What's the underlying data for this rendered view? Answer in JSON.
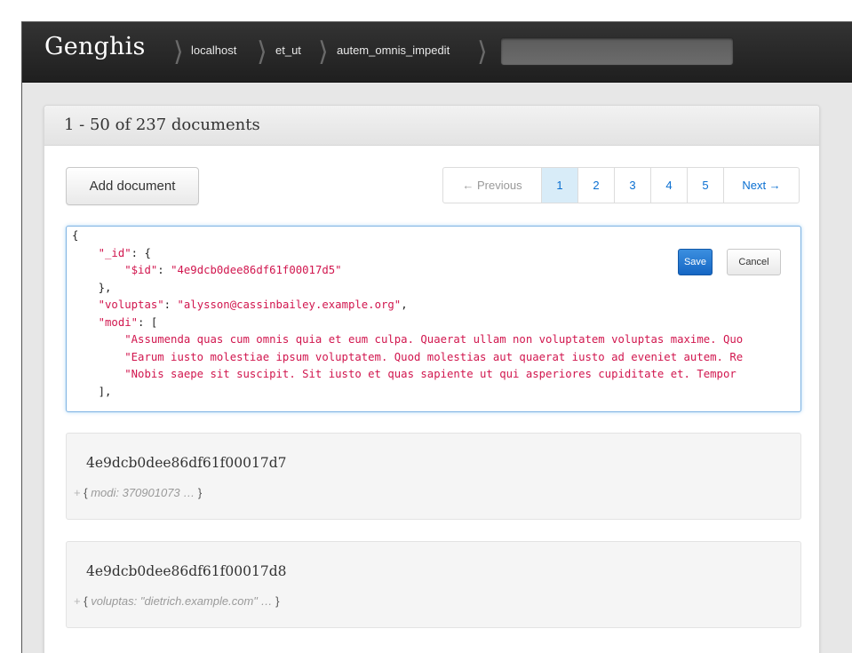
{
  "app": {
    "brand": "Genghis"
  },
  "breadcrumbs": [
    "localhost",
    "et_ut",
    "autem_omnis_impedit"
  ],
  "search": {
    "value": "",
    "placeholder": ""
  },
  "panel": {
    "title": "1 - 50 of 237 documents"
  },
  "toolbar": {
    "add_label": "Add document"
  },
  "pagination": {
    "prev_label": "← Previous",
    "pages": [
      "1",
      "2",
      "3",
      "4",
      "5"
    ],
    "active_page": "1",
    "next_label": "Next →"
  },
  "editor": {
    "save_label": "Save",
    "cancel_label": "Cancel",
    "lines": {
      "l0": "{",
      "l1_key": "\"_id\"",
      "l1_rest": ": {",
      "l2_key": "\"$id\"",
      "l2_sep": ": ",
      "l2_val": "\"4e9dcb0dee86df61f00017d5\"",
      "l3": "},",
      "l4_key": "\"voluptas\"",
      "l4_sep": ": ",
      "l4_val": "\"alysson@cassinbailey.example.org\"",
      "l4_end": ",",
      "l5_key": "\"modi\"",
      "l5_rest": ": [",
      "l6": "\"Assumenda quas cum omnis quia et eum culpa. Quaerat ullam non voluptatem voluptas maxime. Quo",
      "l7": "\"Earum iusto molestiae ipsum voluptatem. Quod molestias aut quaerat iusto ad eveniet autem. Re",
      "l8": "\"Nobis saepe sit suscipit. Sit iusto et quas sapiente ut qui asperiores cupiditate et. Tempor",
      "l9": "],"
    }
  },
  "documents": [
    {
      "id": "4e9dcb0dee86df61f00017d7",
      "plus": "+",
      "open": "{",
      "summary": "modi: 370901073 …",
      "close": "}"
    },
    {
      "id": "4e9dcb0dee86df61f00017d8",
      "plus": "+",
      "open": "{",
      "summary": "voluptas: \"dietrich.example.com\" …",
      "close": "}"
    }
  ]
}
